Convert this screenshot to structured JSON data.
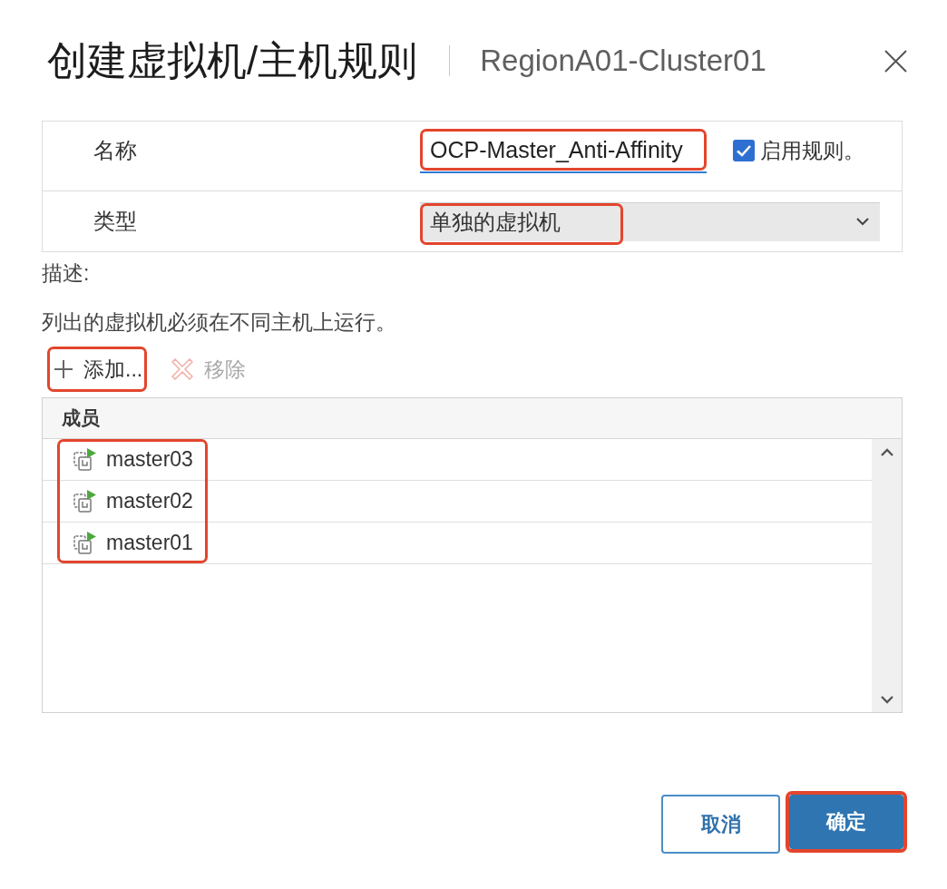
{
  "dialog": {
    "title": "创建虚拟机/主机规则",
    "subtitle": "RegionA01-Cluster01"
  },
  "form": {
    "name": {
      "label": "名称",
      "value": "OCP-Master_Anti-Affinity",
      "highlighted": true
    },
    "enable_rule": {
      "label": "启用规则。",
      "checked": true
    },
    "type": {
      "label": "类型",
      "value": "单独的虚拟机",
      "highlighted": true
    }
  },
  "description": {
    "label": "描述:",
    "text": "列出的虚拟机必须在不同主机上运行。"
  },
  "toolbar": [
    {
      "kind": "add",
      "label": "添加...",
      "disabled": false,
      "highlighted": true
    },
    {
      "kind": "remove",
      "label": "移除",
      "disabled": true,
      "highlighted": false
    }
  ],
  "members": {
    "column": "成员",
    "highlighted": true,
    "rows": [
      {
        "name": "master03"
      },
      {
        "name": "master02"
      },
      {
        "name": "master01"
      }
    ]
  },
  "buttons": [
    {
      "kind": "secondary",
      "label": "取消",
      "highlighted": false
    },
    {
      "kind": "primary",
      "label": "确定",
      "highlighted": true
    }
  ]
}
